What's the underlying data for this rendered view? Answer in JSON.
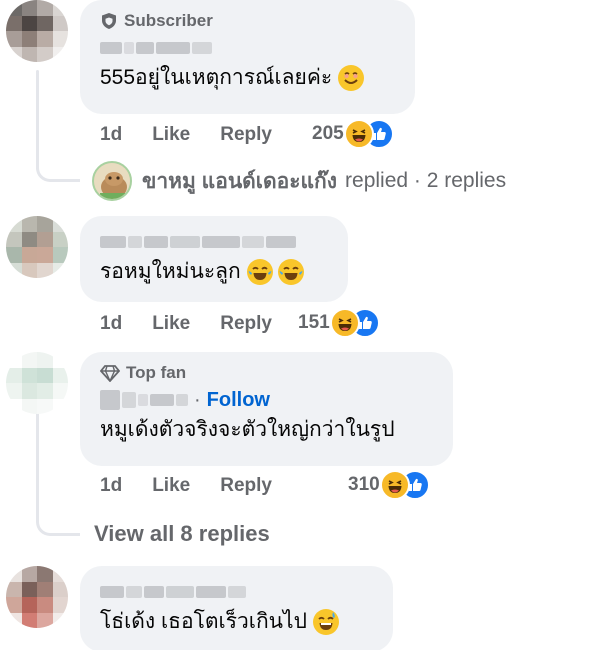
{
  "comments": [
    {
      "badge": "Subscriber",
      "badge_icon": "shield-icon",
      "text": "555อยู่ในเหตุการณ์เลยค่ะ",
      "text_emoji": "smiling-face-emoji",
      "time": "1d",
      "like_label": "Like",
      "reply_label": "Reply",
      "reaction_count": "205"
    },
    {
      "badge": "",
      "text": "รอหมูใหม่นะลูก",
      "text_emoji": "tears-of-joy-emoji",
      "time": "1d",
      "like_label": "Like",
      "reply_label": "Reply",
      "reaction_count": "151"
    },
    {
      "badge": "Top fan",
      "badge_icon": "diamond-icon",
      "follow_label": "Follow",
      "follow_sep": "·",
      "text": "หมูเด้งตัวจริงจะตัวใหญ่กว่าในรูป",
      "time": "1d",
      "like_label": "Like",
      "reply_label": "Reply",
      "reaction_count": "310"
    },
    {
      "badge": "",
      "text": "โธ่เด้ง เธอโตเร็วเกินไป",
      "text_emoji": "grinning-sweat-emoji"
    }
  ],
  "replied_row": {
    "name": "ขาหมู แอนด์เดอะแก๊ง",
    "suffix": "replied · 2 replies"
  },
  "view_all": "View all 8 replies",
  "colors": {
    "bubble": "#f0f2f5",
    "muted_text": "#65676b",
    "link_blue": "#0064d1",
    "like_blue": "#1877f2",
    "haha_yellow": "#f7b928"
  }
}
